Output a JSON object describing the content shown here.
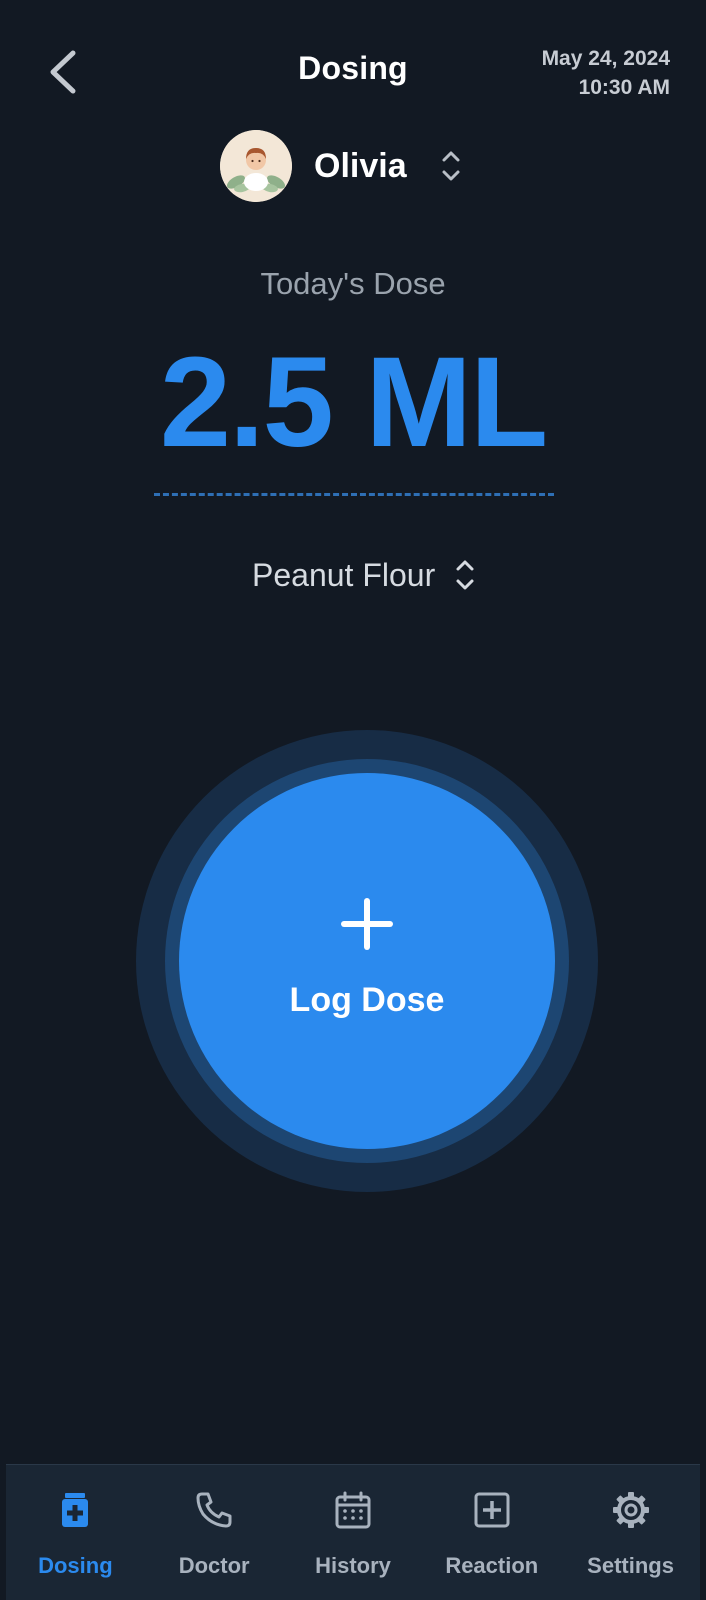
{
  "header": {
    "title": "Dosing",
    "date": "May 24, 2024",
    "time": "10:30 AM"
  },
  "profile": {
    "name": "Olivia"
  },
  "dose": {
    "label": "Today's Dose",
    "value": "2.5 ML",
    "allergen": "Peanut Flour"
  },
  "action": {
    "log_label": "Log Dose"
  },
  "nav": {
    "items": [
      {
        "label": "Dosing",
        "icon": "medicine-box-icon",
        "active": true
      },
      {
        "label": "Doctor",
        "icon": "phone-icon",
        "active": false
      },
      {
        "label": "History",
        "icon": "calendar-icon",
        "active": false
      },
      {
        "label": "Reaction",
        "icon": "plus-square-icon",
        "active": false
      },
      {
        "label": "Settings",
        "icon": "gear-icon",
        "active": false
      }
    ]
  },
  "colors": {
    "background": "#121923",
    "accent": "#2b8aee",
    "nav_background": "#1a2634",
    "muted_text": "#9aa3ad"
  }
}
